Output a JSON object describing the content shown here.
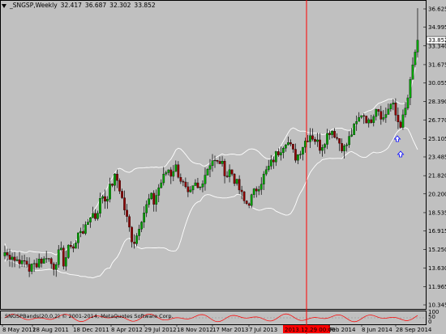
{
  "header": {
    "symbol": "_SNGSP,Weekly",
    "open": "32.417",
    "high": "36.687",
    "low": "32.302",
    "close": "33.852"
  },
  "copyright": "SNGSPBands(20,0,2) © 2001-2014, MetaQuotes Software Corp.",
  "sub_panel_labels": [
    "100",
    "50",
    "0"
  ],
  "current_price": "33.852",
  "crosshair_date": "2013.12.29 00:00",
  "colors": {
    "background": "#c0c0c0",
    "bull": "#00a000",
    "bear": "#8b0000",
    "band": "#ffffff",
    "crosshair": "#ff0000",
    "grid": "#a8a8a8",
    "arrow": "#0000ff"
  },
  "chart_data": {
    "type": "candlestick",
    "y_ticks": [
      "36.625",
      "34.995",
      "33.340",
      "31.675",
      "30.055",
      "28.390",
      "26.770",
      "25.105",
      "23.485",
      "21.820",
      "20.200",
      "18.535",
      "16.915",
      "15.250",
      "13.630",
      "11.965",
      "10.345"
    ],
    "x_ticks": [
      "8 May 2011",
      "28 Aug 2011",
      "18 Dec 2011",
      "8 Apr 2012",
      "29 Jul 2012",
      "18 Nov 2012",
      "17 Mar 2013",
      "7 Jul 2013",
      "2013.12.29 00:00",
      "Feb 2014",
      "8 Jun 2014",
      "28 Sep 2014"
    ],
    "ylim": [
      10.345,
      36.625
    ],
    "close_path": [
      15.0,
      14.6,
      14.9,
      14.2,
      14.5,
      13.9,
      14.3,
      13.5,
      13.8,
      14.0,
      14.5,
      14.1,
      14.8,
      14.2,
      13.7,
      14.5,
      15.2,
      14.0,
      15.0,
      15.8,
      15.3,
      16.5,
      17.2,
      16.8,
      17.8,
      18.6,
      18.1,
      19.0,
      20.2,
      19.6,
      20.5,
      21.2,
      21.8,
      20.8,
      19.5,
      18.2,
      17.0,
      15.8,
      16.5,
      17.8,
      18.5,
      19.2,
      20.0,
      19.4,
      20.5,
      21.2,
      21.8,
      22.5,
      21.9,
      22.8,
      22.0,
      21.3,
      20.6,
      19.8,
      20.5,
      21.0,
      20.4,
      21.5,
      22.2,
      22.9,
      23.3,
      22.8,
      23.1,
      22.5,
      21.8,
      22.4,
      21.6,
      21.0,
      20.3,
      19.5,
      19.3,
      19.8,
      20.4,
      20.9,
      21.4,
      22.0,
      22.5,
      23.0,
      23.6,
      24.0,
      24.5,
      25.0,
      24.6,
      23.9,
      23.4,
      24.0,
      24.6,
      25.1,
      25.5,
      25.2,
      24.8,
      24.3,
      24.9,
      25.5,
      26.0,
      25.6,
      25.0,
      24.5,
      24.2,
      24.9,
      25.6,
      26.2,
      26.8,
      27.5,
      27.0,
      26.4,
      27.2,
      28.0,
      27.6,
      26.8,
      27.4,
      28.2,
      27.9,
      26.8,
      26.4,
      27.0,
      28.4,
      30.2,
      32.4,
      33.85
    ],
    "bollinger": {
      "period": 20,
      "deviation": 2
    },
    "price_marker": "33.852"
  }
}
